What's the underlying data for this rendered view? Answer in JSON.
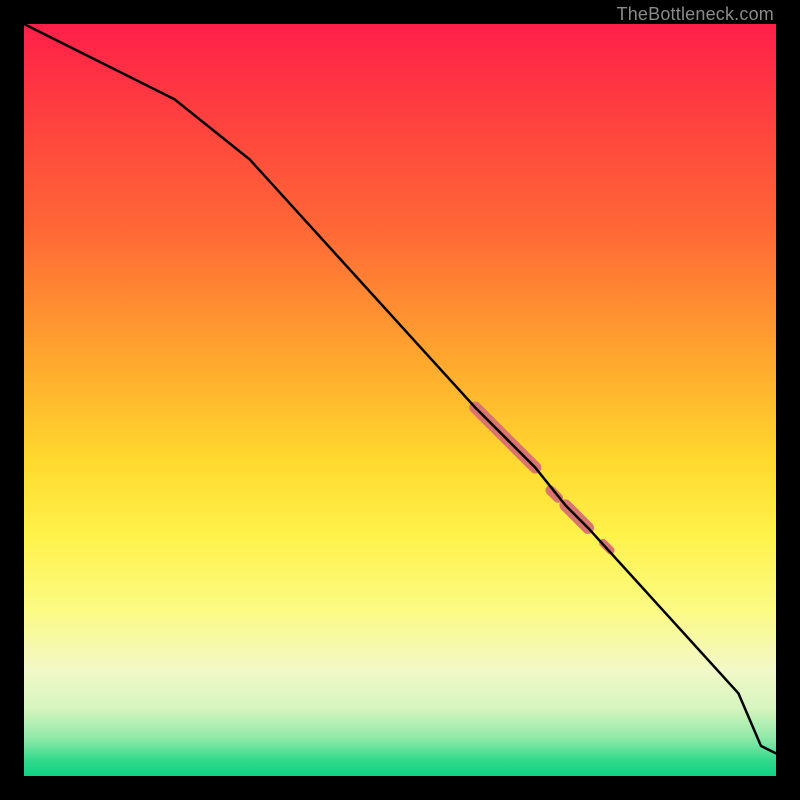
{
  "attribution": "TheBottleneck.com",
  "colors": {
    "line": "#000000",
    "highlight": "#d9746f",
    "gradient_top": "#ff1f49",
    "gradient_bottom": "#0fd084"
  },
  "chart_data": {
    "type": "line",
    "title": "",
    "xlabel": "",
    "ylabel": "",
    "xlim": [
      0,
      100
    ],
    "ylim": [
      0,
      100
    ],
    "x": [
      0,
      10,
      20,
      30,
      40,
      50,
      60,
      65,
      68,
      72,
      75,
      85,
      95,
      98,
      100
    ],
    "values": [
      100,
      95,
      90,
      82,
      71,
      60,
      49,
      44,
      41,
      36,
      33,
      22,
      11,
      4,
      3
    ],
    "highlighted_segments": [
      {
        "x0": 60,
        "y0": 49,
        "x1": 68,
        "y1": 41,
        "width": 12
      },
      {
        "x0": 70,
        "y0": 38,
        "x1": 71,
        "y1": 37,
        "width": 10
      },
      {
        "x0": 72,
        "y0": 36,
        "x1": 75,
        "y1": 33,
        "width": 12
      },
      {
        "x0": 77,
        "y0": 31,
        "x1": 78,
        "y1": 30,
        "width": 8
      }
    ]
  }
}
